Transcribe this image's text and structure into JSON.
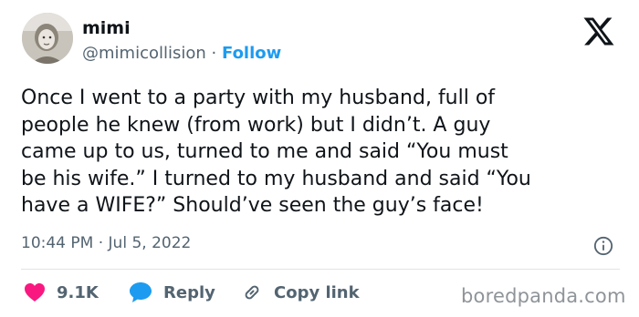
{
  "author": {
    "name": "mimi",
    "handle": "@mimicollision",
    "separator": "·",
    "follow_label": "Follow"
  },
  "tweet": {
    "text": "Once I went to a party with my husband, full of\npeople he knew (from work)  but I didn’t. A guy\ncame up to us, turned to me and said “You must\nbe his wife.” I turned to my husband and said “You\nhave a WIFE?” Should’ve seen the guy’s face!",
    "timestamp": "10:44 PM · Jul 5, 2022"
  },
  "actions": {
    "like_count": "9.1K",
    "reply_label": "Reply",
    "copy_link_label": "Copy link"
  },
  "watermark": "boredpanda.com",
  "colors": {
    "text": "#0f1419",
    "secondary": "#536471",
    "accent": "#1d9bf0",
    "like": "#f91880",
    "divider": "#dfe4e8"
  },
  "icons": [
    "x-logo-icon",
    "info-icon",
    "heart-icon",
    "reply-bubble-icon",
    "link-icon"
  ]
}
